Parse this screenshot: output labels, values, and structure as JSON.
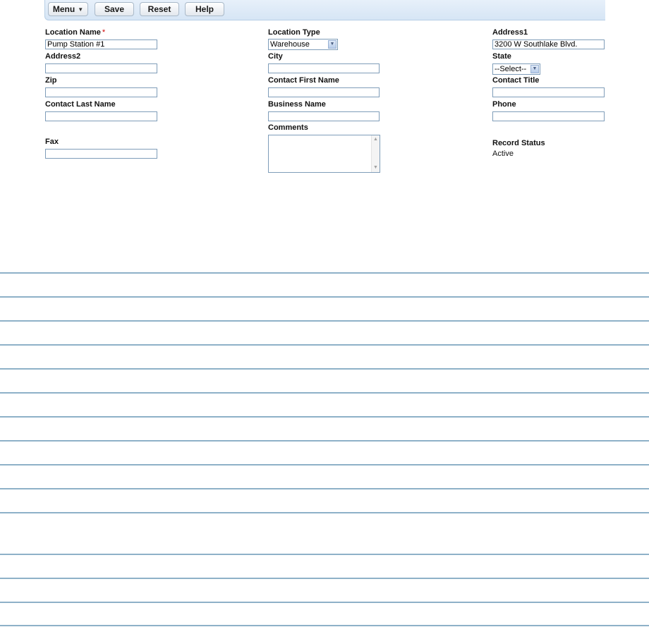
{
  "toolbar": {
    "menu_label": "Menu",
    "save_label": "Save",
    "reset_label": "Reset",
    "help_label": "Help"
  },
  "form": {
    "location_name": {
      "label": "Location Name",
      "required_mark": "*",
      "value": "Pump Station #1"
    },
    "location_type": {
      "label": "Location Type",
      "value": "Warehouse"
    },
    "address1": {
      "label": "Address1",
      "value": "3200 W Southlake Blvd."
    },
    "address2": {
      "label": "Address2",
      "value": ""
    },
    "city": {
      "label": "City",
      "value": ""
    },
    "state": {
      "label": "State",
      "value": "--Select--"
    },
    "zip": {
      "label": "Zip",
      "value": ""
    },
    "contact_first_name": {
      "label": "Contact First Name",
      "value": ""
    },
    "contact_title": {
      "label": "Contact Title",
      "value": ""
    },
    "contact_last_name": {
      "label": "Contact Last Name",
      "value": ""
    },
    "business_name": {
      "label": "Business Name",
      "value": ""
    },
    "phone": {
      "label": "Phone",
      "value": ""
    },
    "comments": {
      "label": "Comments",
      "value": ""
    },
    "fax": {
      "label": "Fax",
      "value": ""
    },
    "record_status": {
      "label": "Record Status",
      "value": "Active"
    }
  },
  "colors": {
    "toolbar_bg": "#dde9f7",
    "input_border": "#7f9db9",
    "rule_line": "#8eb1c8",
    "required": "#cc0000"
  }
}
